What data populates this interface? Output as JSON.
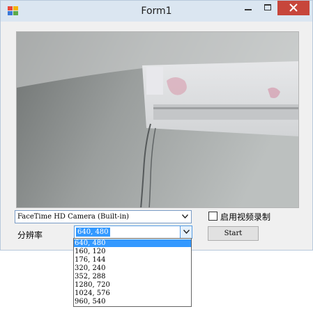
{
  "window": {
    "title": "Form1",
    "controls": {
      "minimize_icon": "minimize-icon",
      "maximize_icon": "maximize-icon",
      "close_icon": "close-icon"
    },
    "close_color": "#c7463b"
  },
  "camera_combo": {
    "value": "FaceTime HD Camera (Built-in)",
    "icon": "chevron-down-icon"
  },
  "resolution": {
    "label": "分辨率",
    "value": "640, 480",
    "icon": "chevron-down-icon",
    "options": [
      "640, 480",
      "160, 120",
      "176, 144",
      "320, 240",
      "352, 288",
      "1280, 720",
      "1024, 576",
      "960, 540"
    ],
    "selected_index": 0
  },
  "record_checkbox": {
    "label": "启用视频录制",
    "checked": false
  },
  "start_button": {
    "label": "Start"
  },
  "colors": {
    "selection": "#3399ff",
    "titlebar": "#dbe6f1",
    "form_bg": "#f0f0f0"
  }
}
